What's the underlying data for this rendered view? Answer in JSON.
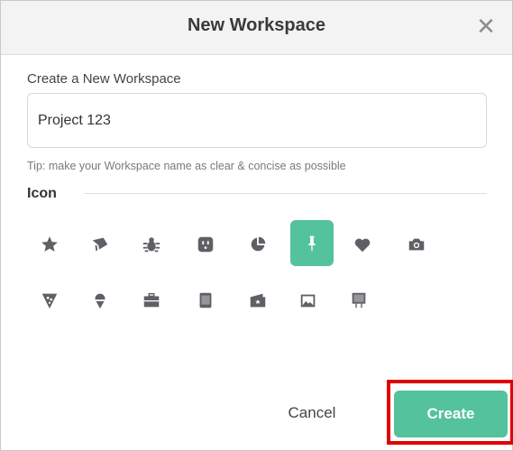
{
  "dialog": {
    "title": "New Workspace",
    "close_label": "✕",
    "section_label": "Create a New Workspace",
    "name_input": {
      "value": "Project 123",
      "placeholder": ""
    },
    "tip": "Tip: make your Workspace name as clear & concise as possible",
    "icon_heading": "Icon",
    "icons": [
      {
        "name": "star-icon",
        "selected": false
      },
      {
        "name": "graduation-cap-icon",
        "selected": false
      },
      {
        "name": "bug-icon",
        "selected": false
      },
      {
        "name": "power-outlet-icon",
        "selected": false
      },
      {
        "name": "pie-chart-icon",
        "selected": false
      },
      {
        "name": "pushpin-icon",
        "selected": true
      },
      {
        "name": "heart-icon",
        "selected": false
      },
      {
        "name": "camera-icon",
        "selected": false
      },
      {
        "name": "pizza-icon",
        "selected": false
      },
      {
        "name": "ice-cream-icon",
        "selected": false
      },
      {
        "name": "briefcase-icon",
        "selected": false
      },
      {
        "name": "notepad-icon",
        "selected": false
      },
      {
        "name": "wallet-icon",
        "selected": false
      },
      {
        "name": "photo-icon",
        "selected": false
      },
      {
        "name": "presentation-board-icon",
        "selected": false
      }
    ],
    "cancel_label": "Cancel",
    "create_label": "Create"
  },
  "colors": {
    "accent": "#55c29e",
    "icon_gray": "#5f5f66",
    "highlight": "#e00000"
  }
}
